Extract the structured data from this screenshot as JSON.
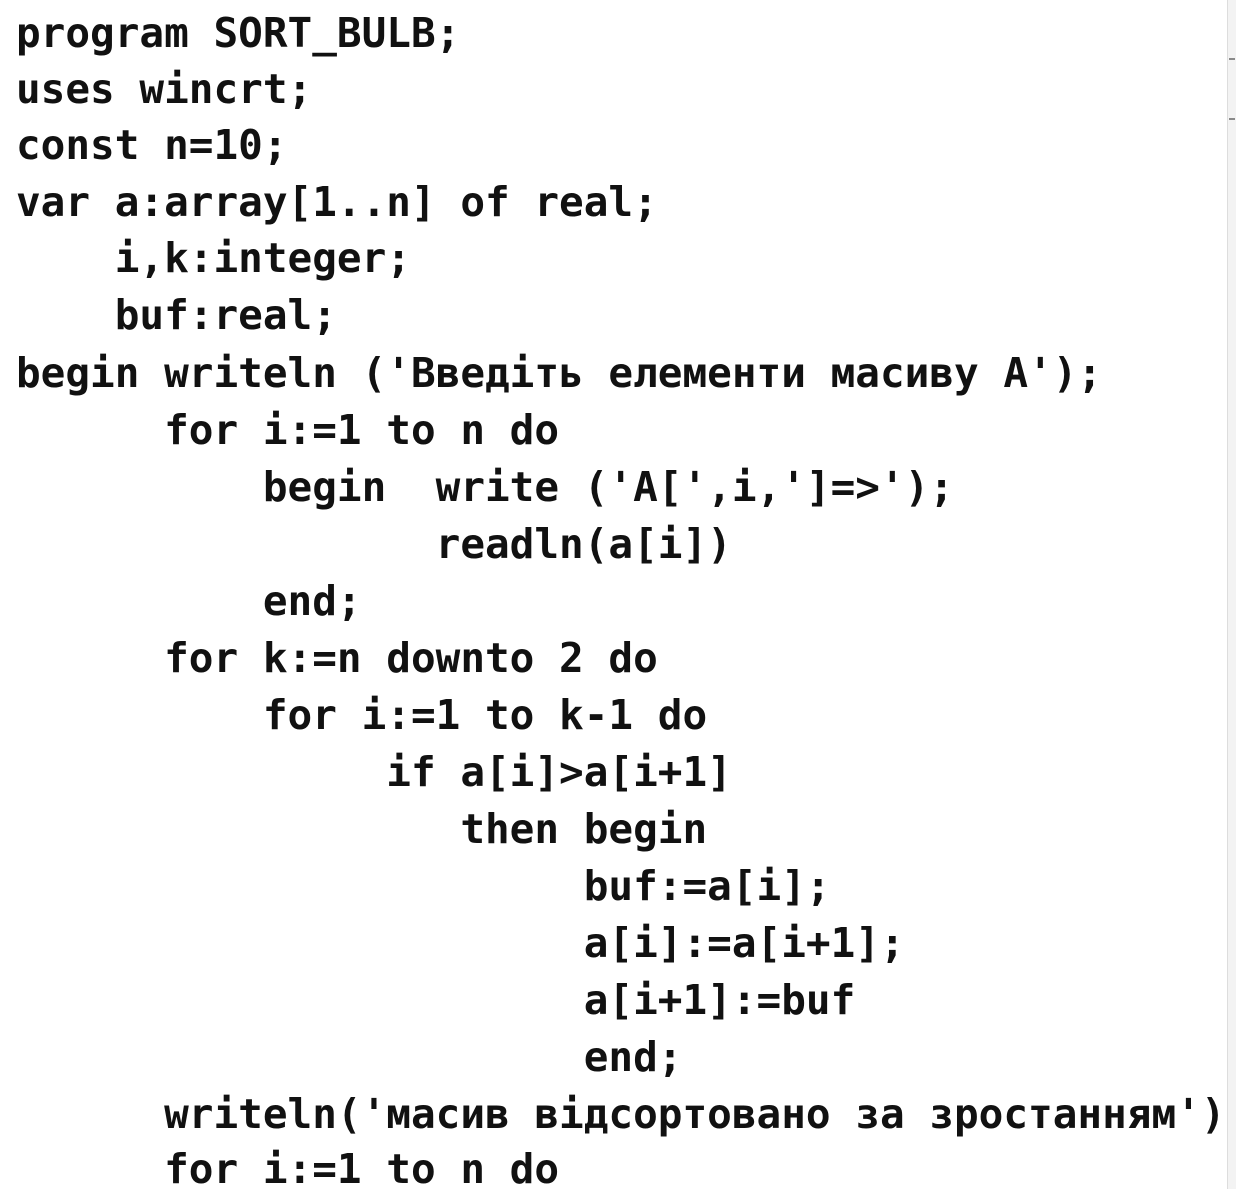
{
  "code": {
    "lines": [
      "program SORT_BULB;",
      "uses wincrt;",
      "const n=10;",
      "var a:array[1..n] of real;",
      "    i,k:integer;",
      "    buf:real;",
      "begin writeln ('Введіть елементи масиву A');",
      "      for i:=1 to n do",
      "          begin  write ('A[',i,']=>');",
      "                 readln(a[i])",
      "          end;",
      "      for k:=n downto 2 do",
      "          for i:=1 to k-1 do",
      "               if a[i]>a[i+1]",
      "                  then begin",
      "                       buf:=a[i];",
      "                       a[i]:=a[i+1];",
      "                       a[i+1]:=buf",
      "                       end;",
      "      writeln('масив відсортовано за зростанням');",
      "      for i:=1 to n do"
    ]
  }
}
